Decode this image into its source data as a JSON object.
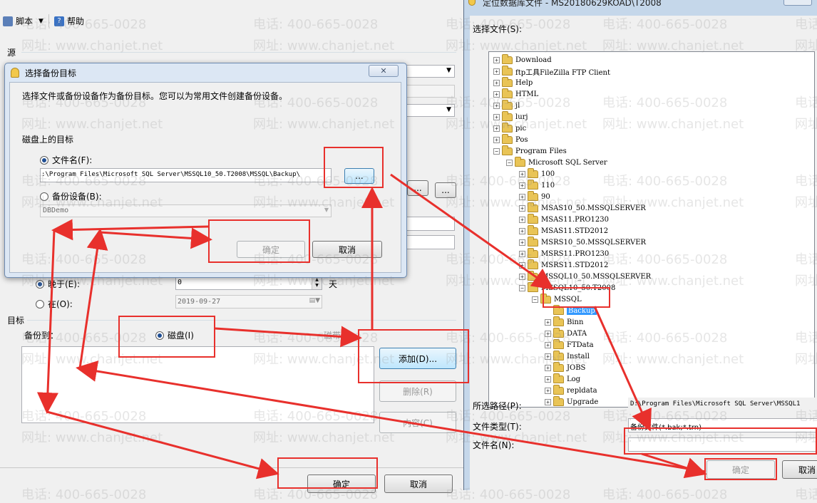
{
  "toolbar": {
    "script_label": "脚本",
    "help_label": "帮助"
  },
  "main": {
    "source_label": "源",
    "target_label": "目标",
    "backup_to_label": "备份到：",
    "disk_label": "磁盘(I)",
    "after_label": "晚于(E):",
    "after_value": "0",
    "after_unit": "天",
    "on_label": "在(O):",
    "date_value": "2019-09-27",
    "tape_label": "磁带(P)",
    "add_button": "添加(D)...",
    "remove_button": "删除(R)",
    "content_button": "内容(C)",
    "ok_button": "确定",
    "cancel_button": "取消",
    "small_button": "..."
  },
  "modal": {
    "title": "选择备份目标",
    "description": "选择文件或备份设备作为备份目标。您可以为常用文件创建备份设备。",
    "disk_target_label": "磁盘上的目标",
    "filename_label": "文件名(F):",
    "filename_value": ":\\Program Files\\Microsoft SQL Server\\MSSQL10_50.T2008\\MSSQL\\Backup\\",
    "browse_button": "...",
    "device_label": "备份设备(B):",
    "device_value": "DBDemo",
    "ok_button": "确定",
    "cancel_button": "取消"
  },
  "file_dialog": {
    "title": "定位数据库文件 - MS20180629KOAD\\T2008",
    "select_file_label": "选择文件(S):",
    "tree": [
      {
        "label": "Download",
        "level": 0,
        "exp": "+"
      },
      {
        "label": "ftp工具FileZilla FTP Client",
        "level": 0,
        "exp": "+"
      },
      {
        "label": "Help",
        "level": 0,
        "exp": "+"
      },
      {
        "label": "HTML",
        "level": 0,
        "exp": "+"
      },
      {
        "label": "jl",
        "level": 0,
        "exp": "+"
      },
      {
        "label": "lurj",
        "level": 0,
        "exp": "+"
      },
      {
        "label": "pic",
        "level": 0,
        "exp": "+"
      },
      {
        "label": "Pos",
        "level": 0,
        "exp": "+"
      },
      {
        "label": "Program Files",
        "level": 0,
        "exp": "-"
      },
      {
        "label": "Microsoft SQL Server",
        "level": 1,
        "exp": "-"
      },
      {
        "label": "100",
        "level": 2,
        "exp": "+"
      },
      {
        "label": "110",
        "level": 2,
        "exp": "+"
      },
      {
        "label": "90",
        "level": 2,
        "exp": "+"
      },
      {
        "label": "MSAS10_50.MSSQLSERVER",
        "level": 2,
        "exp": "+"
      },
      {
        "label": "MSAS11.PRO1230",
        "level": 2,
        "exp": "+"
      },
      {
        "label": "MSAS11.STD2012",
        "level": 2,
        "exp": "+"
      },
      {
        "label": "MSRS10_50.MSSQLSERVER",
        "level": 2,
        "exp": "+"
      },
      {
        "label": "MSRS11.PRO1230",
        "level": 2,
        "exp": "+"
      },
      {
        "label": "MSRS11.STD2012",
        "level": 2,
        "exp": "+"
      },
      {
        "label": "MSSQL10_50.MSSQLSERVER",
        "level": 2,
        "exp": "+"
      },
      {
        "label": "MSSQL10_50.T2008",
        "level": 2,
        "exp": "-"
      },
      {
        "label": "MSSQL",
        "level": 3,
        "exp": "-"
      },
      {
        "label": "Backup",
        "level": 4,
        "exp": "",
        "selected": true
      },
      {
        "label": "Binn",
        "level": 4,
        "exp": "+"
      },
      {
        "label": "DATA",
        "level": 4,
        "exp": "+"
      },
      {
        "label": "FTData",
        "level": 4,
        "exp": "+"
      },
      {
        "label": "Install",
        "level": 4,
        "exp": "+"
      },
      {
        "label": "JOBS",
        "level": 4,
        "exp": "+"
      },
      {
        "label": "Log",
        "level": 4,
        "exp": "+"
      },
      {
        "label": "repldata",
        "level": 4,
        "exp": "+"
      },
      {
        "label": "Upgrade",
        "level": 4,
        "exp": "+"
      }
    ],
    "path_label": "所选路径(P):",
    "path_value": "D:\\Program Files\\Microsoft SQL Server\\MSSQL1",
    "filetype_label": "文件类型(T):",
    "filetype_value": "备份文件(*.bak;*.trn)",
    "filename_label": "文件名(N):",
    "filename_value": "",
    "ok_button": "确定",
    "cancel_button": "取消"
  },
  "watermark": {
    "phone": "电话: 400-665-0028",
    "site": "网址: www.chanjet.net"
  },
  "colors": {
    "annotation_red": "#e8302c",
    "selection_blue": "#3399ff"
  }
}
